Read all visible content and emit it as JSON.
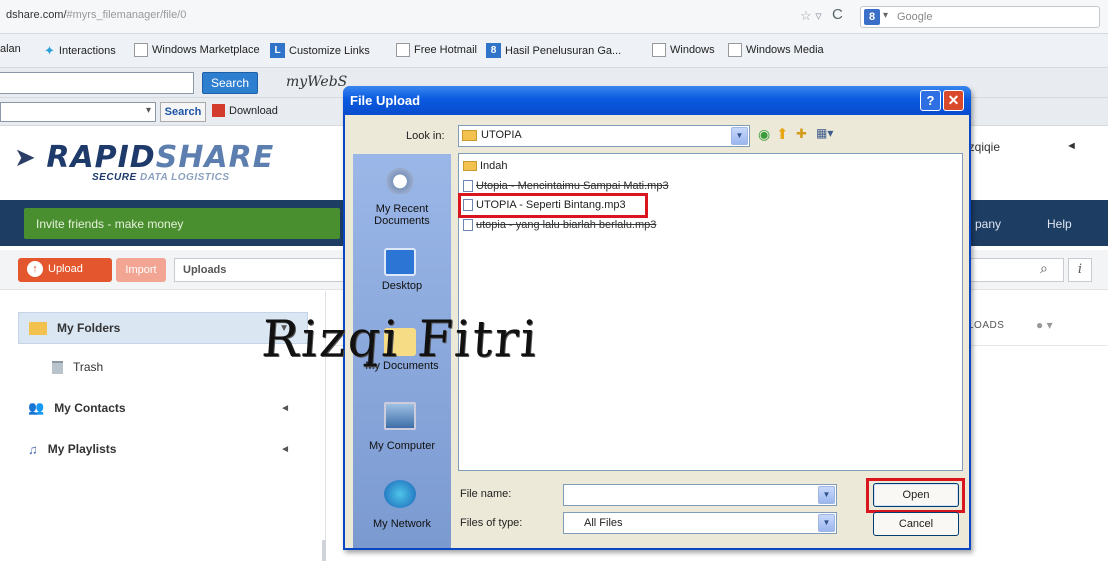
{
  "browser": {
    "url_dark": "dshare.com/",
    "url_light": "#myrs_filemanager/file/0",
    "search_engine_placeholder": "Google"
  },
  "bookmarks": {
    "item_1": "alan",
    "item_2": "Interactions",
    "item_3": "Windows Marketplace",
    "item_4": "Customize Links",
    "item_5": "Free Hotmail",
    "item_6": "Hasil Penelusuran Ga...",
    "item_7": "Windows",
    "item_8": "Windows Media"
  },
  "toolbar": {
    "search_label": "Search",
    "mywebsearch": "myWebS",
    "search_small": "Search",
    "download": "Download"
  },
  "rapidshare": {
    "logo_a": "RAPID",
    "logo_b": "SHARE",
    "tagline_a": "SECURE",
    "tagline_b": "DATA LOGISTICS",
    "username": "rizqiqie",
    "invite": "Invite friends - make money",
    "nav_company": "pany",
    "nav_help": "Help",
    "upload_btn": "Upload",
    "import_btn": "Import",
    "uploads_box": "Uploads",
    "uploads_right": "LOADS",
    "sidebar": {
      "my_folders": "My Folders",
      "trash": "Trash",
      "my_contacts": "My Contacts",
      "my_playlists": "My Playlists"
    }
  },
  "dialog": {
    "title": "File Upload",
    "look_in_label": "Look in:",
    "look_in_value": "UTOPIA",
    "places": {
      "recent": "My Recent Documents",
      "desktop": "Desktop",
      "documents": "My Documents",
      "computer": "My Computer",
      "network": "My Network"
    },
    "files": {
      "folder": "Indah",
      "file_1": "Utopia - Mencintaimu Sampai Mati.mp3",
      "file_2": "UTOPIA - Seperti Bintang.mp3",
      "file_3": "utopia - yang lalu biarlah berlalu.mp3"
    },
    "file_name_label": "File name:",
    "file_name_value": "",
    "file_type_label": "Files of type:",
    "file_type_value": "All Files",
    "open_btn": "Open",
    "cancel_btn": "Cancel"
  },
  "watermark": "Rizqi Fitri",
  "colors": {
    "xp_title": "#0a5ae0",
    "highlight_red": "#d9161e",
    "rs_nav": "#1e3d62",
    "rs_green": "#4a8f2f",
    "upload_orange": "#e4572e"
  }
}
